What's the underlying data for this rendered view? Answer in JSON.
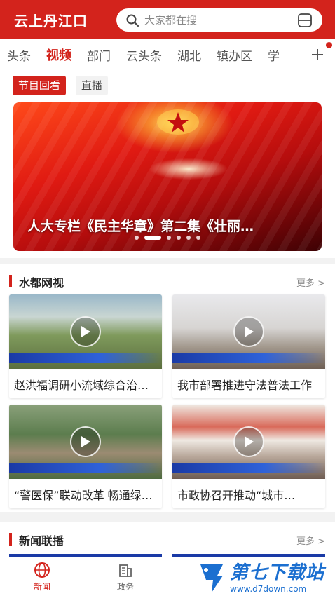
{
  "header": {
    "logo": "云上丹江口",
    "search_placeholder": "大家都在搜"
  },
  "tabs": [
    "头条",
    "视频",
    "部门",
    "云头条",
    "湖北",
    "镇办区",
    "学"
  ],
  "active_tab": "视频",
  "subtabs": [
    "节目回看",
    "直播"
  ],
  "banner": {
    "title": "人大专栏《民主华章》第二集《壮丽…",
    "slide_count": 6,
    "active_slide": 1
  },
  "section1": {
    "title": "水都网视",
    "more": "更多 >",
    "videos": [
      {
        "title": "赵洪福调研小流域综合治理工作"
      },
      {
        "title": "我市部署推进守法普法工作"
      },
      {
        "title": "“警医保”联动改革 畅通绿色通道"
      },
      {
        "title": "市政协召开推动“城市…"
      }
    ]
  },
  "section2": {
    "title": "新闻联播",
    "more": "更多 >"
  },
  "bottom_nav": [
    {
      "label": "新闻"
    },
    {
      "label": "政务"
    }
  ],
  "watermark": {
    "title": "第七下载站",
    "url": "www.d7down.com"
  },
  "colors": {
    "brand_red": "#d3231c",
    "watermark_blue": "#1b6fd0"
  }
}
